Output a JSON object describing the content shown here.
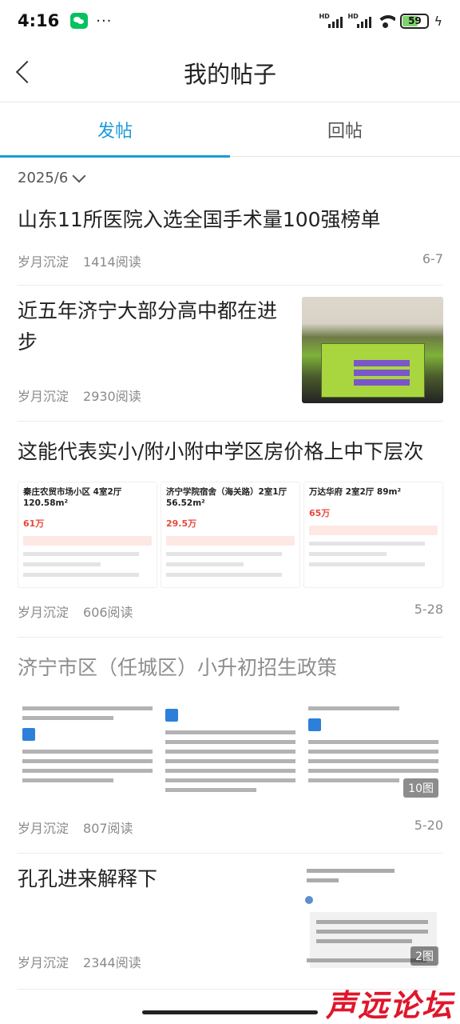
{
  "status_bar": {
    "time": "4:16",
    "dots": "···",
    "signal_label": "HD",
    "battery": "59"
  },
  "header": {
    "title": "我的帖子"
  },
  "tabs": [
    {
      "label": "发帖",
      "active": true
    },
    {
      "label": "回帖",
      "active": false
    }
  ],
  "filter": {
    "month": "2025/6"
  },
  "posts": [
    {
      "title": "山东11所医院入选全国手术量100强榜单",
      "author": "岁月沉淀",
      "reads": "1414阅读",
      "date": "6-7"
    },
    {
      "title": "近五年济宁大部分高中都在进步",
      "author": "岁月沉淀",
      "reads": "2930阅读",
      "date": ""
    },
    {
      "title": "这能代表实小/附小附中学区房价格上中下层次",
      "author": "岁月沉淀",
      "reads": "606阅读",
      "date": "5-28",
      "cards": [
        {
          "title": "秦庄农贸市场小区 4室2厅 120.58m²",
          "price": "61万"
        },
        {
          "title": "济宁学院宿舍（海关路）2室1厅 56.52m²",
          "price": "29.5万"
        },
        {
          "title": "万达华府 2室2厅 89m²",
          "price": "65万"
        }
      ]
    },
    {
      "title": "济宁市区（任城区）小升初招生政策",
      "author": "岁月沉淀",
      "reads": "807阅读",
      "date": "5-20",
      "image_count": "10图"
    },
    {
      "title": "孔孔进来解释下",
      "author": "岁月沉淀",
      "reads": "2344阅读",
      "date": "",
      "image_count": "2图"
    }
  ],
  "watermark": "声远论坛",
  "colors": {
    "accent": "#1d9bd8",
    "price": "#e8483b"
  }
}
